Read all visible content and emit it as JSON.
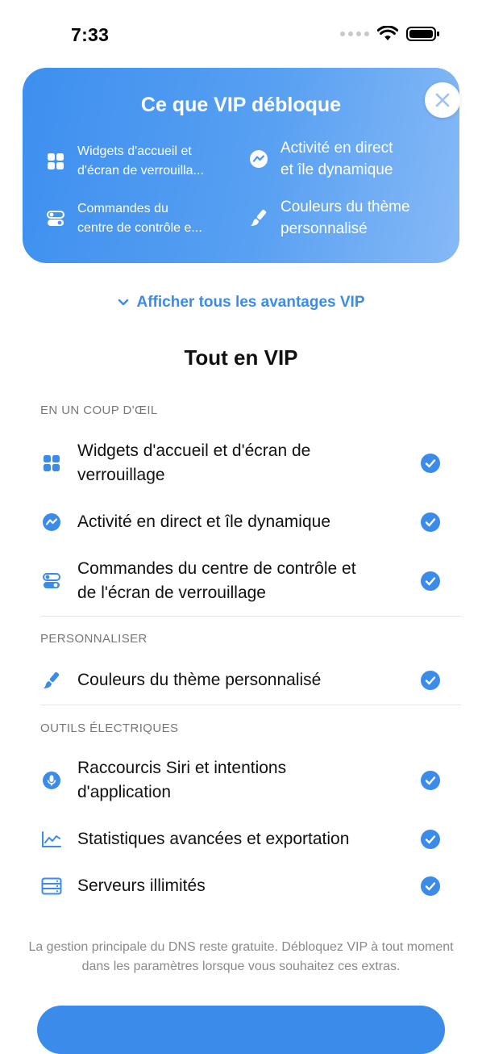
{
  "status_bar": {
    "time": "7:33"
  },
  "hero": {
    "title": "Ce que VIP débloque",
    "features": [
      {
        "icon": "widgets-grid-icon",
        "line1": "Widgets d'accueil et",
        "line2": "d'écran de verrouilla..."
      },
      {
        "icon": "live-activity-icon",
        "line1": "Activité en direct",
        "line2": "et île dynamique"
      },
      {
        "icon": "toggle-controls-icon",
        "line1": "Commandes du",
        "line2": "centre de contrôle e..."
      },
      {
        "icon": "paintbrush-icon",
        "line1": "Couleurs du thème",
        "line2": "personnalisé"
      }
    ]
  },
  "show_all_label": "Afficher tous les avantages VIP",
  "main_title": "Tout en VIP",
  "groups": [
    {
      "header": "EN UN COUP D'ŒIL",
      "items": [
        {
          "icon": "widgets-grid-icon",
          "line1": "Widgets d'accueil et d'écran de",
          "line2": "verrouillage"
        },
        {
          "icon": "live-activity-icon",
          "line1": "Activité en direct et île dynamique"
        },
        {
          "icon": "toggle-controls-icon",
          "line1": "Commandes du centre de contrôle et",
          "line2": "de l'écran de verrouillage"
        }
      ]
    },
    {
      "header": "PERSONNALISER",
      "items": [
        {
          "icon": "paintbrush-icon",
          "line1": "Couleurs du thème personnalisé"
        }
      ]
    },
    {
      "header": "OUTILS ÉLECTRIQUES",
      "items": [
        {
          "icon": "microphone-icon",
          "line1": "Raccourcis Siri et intentions",
          "line2": "d'application"
        },
        {
          "icon": "chart-line-icon",
          "line1": "Statistiques avancées et exportation"
        },
        {
          "icon": "server-stack-icon",
          "line1": "Serveurs illimités"
        }
      ]
    }
  ],
  "footer_note": "La gestion principale du DNS reste gratuite. Débloquez VIP à tout moment dans les paramètres lorsque vous souhaitez ces extras.",
  "colors": {
    "accent": "#3b8bea",
    "hero_start": "#3d8fef",
    "hero_end": "#86b9f6"
  }
}
